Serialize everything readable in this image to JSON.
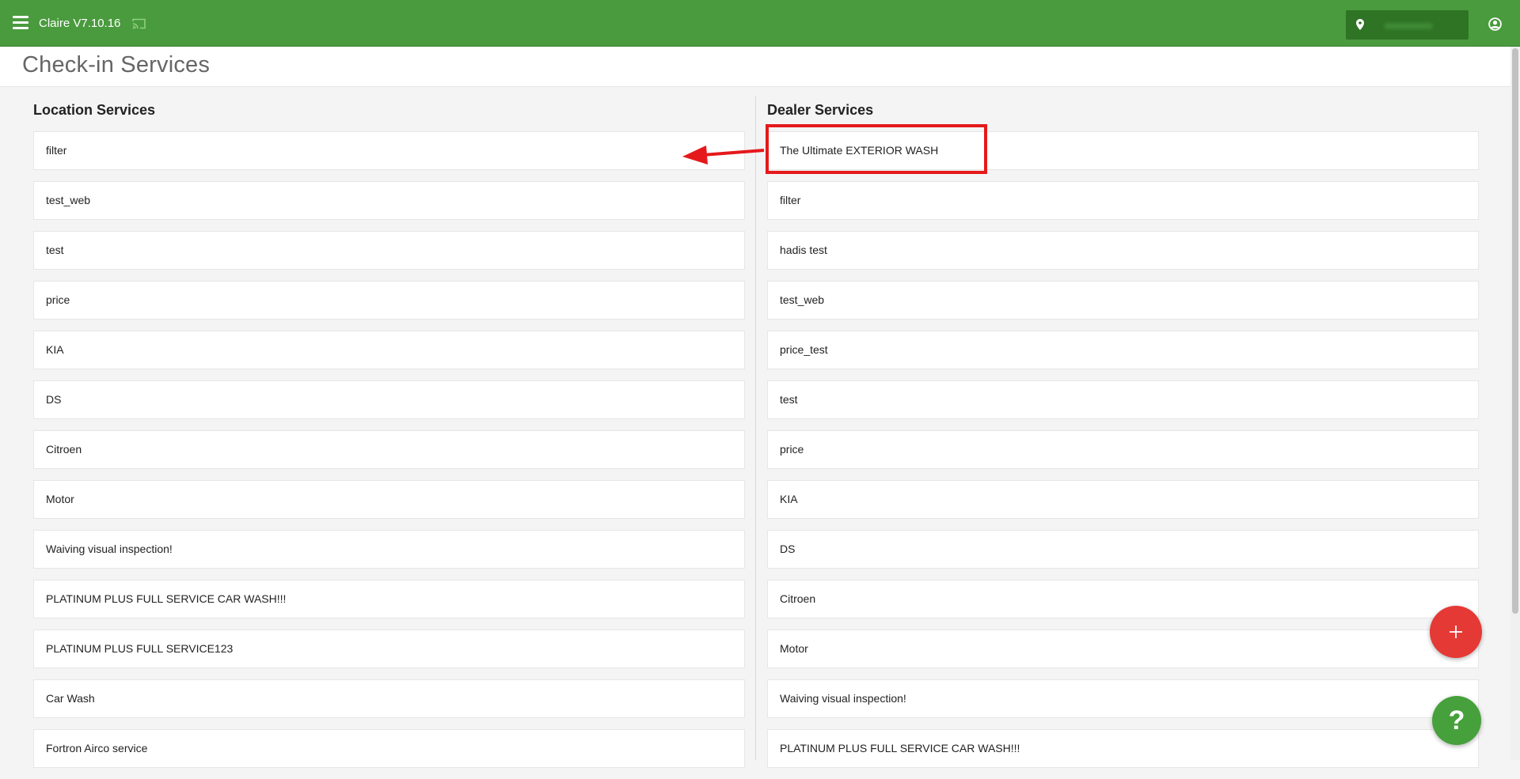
{
  "topbar": {
    "app_title": "Claire V7.10.16",
    "icons": [
      "menu-icon",
      "cast-icon",
      "location-pin-icon",
      "account-circle-icon"
    ],
    "color": "#4a9a3e"
  },
  "page": {
    "title": "Check-in Services"
  },
  "location_services": {
    "title": "Location Services",
    "items": [
      "filter",
      "test_web",
      "test",
      "price",
      "KIA",
      "DS",
      "Citroen",
      "Motor",
      "Waiving visual inspection!",
      "PLATINUM PLUS FULL SERVICE CAR WASH!!!",
      "PLATINUM PLUS FULL SERVICE123",
      "Car Wash",
      "Fortron Airco service"
    ]
  },
  "dealer_services": {
    "title": "Dealer Services",
    "items": [
      "The Ultimate EXTERIOR WASH",
      "filter",
      "hadis test",
      "test_web",
      "price_test",
      "test",
      "price",
      "KIA",
      "DS",
      "Citroen",
      "Motor",
      "Waiving visual inspection!",
      "PLATINUM PLUS FULL SERVICE CAR WASH!!!"
    ]
  },
  "fab": {
    "help_label": "?",
    "add_color": "#e53935",
    "help_color": "#46a03b"
  },
  "annotation": {
    "color": "#e5191b"
  }
}
